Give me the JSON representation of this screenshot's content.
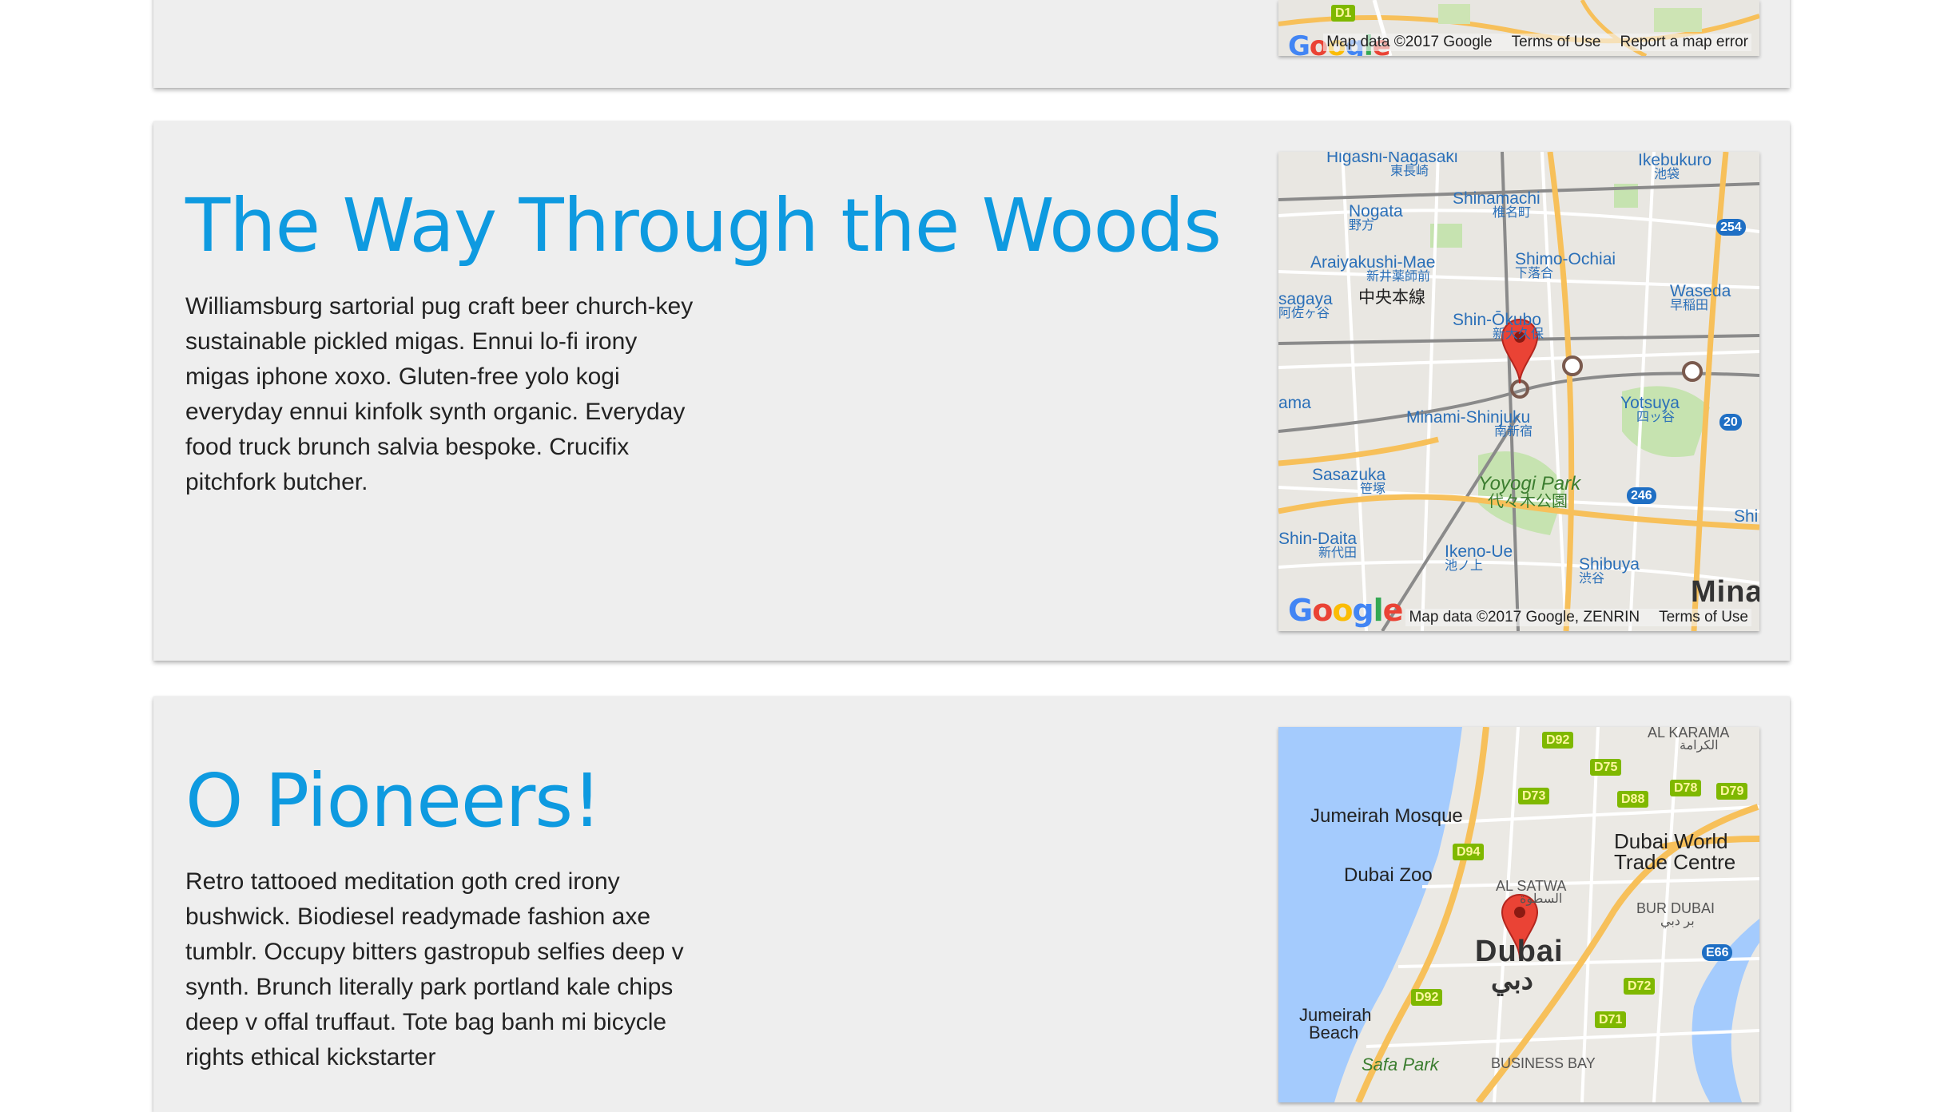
{
  "cards": [
    {
      "map": {
        "attribution": [
          "Map data ©2017 Google",
          "Terms of Use",
          "Report a map error"
        ],
        "logo": "Google",
        "partial_labels": [
          "D1"
        ]
      }
    },
    {
      "title": "The Way Through the Woods",
      "body": "Williamsburg sartorial pug craft beer church-key sustainable pickled migas. Ennui lo-fi irony migas iphone xoxo. Gluten-free yolo kogi everyday ennui kinfolk synth organic. Everyday food truck brunch salvia bespoke. Crucifix pitchfork butcher.",
      "map": {
        "attribution": [
          "Map data ©2017 Google, ZENRIN",
          "Terms of Use"
        ],
        "logo": "Google",
        "places": {
          "higashi_nagasaki": "Higashi-Nagasaki",
          "higashi_nagasaki_jp": "東長崎",
          "ikebukuro": "Ikebukuro",
          "ikebukuro_jp": "池袋",
          "nogata": "Nogata",
          "nogata_jp": "野方",
          "shinamachi": "Shinamachi",
          "shinamachi_jp": "椎名町",
          "araiyakushi": "Araiyakushi-Mae",
          "araiyakushi_jp": "新井薬師前",
          "shimo_ochiai": "Shimo-Ochiai",
          "shimo_ochiai_jp": "下落合",
          "waseda": "Waseda",
          "waseda_jp": "早稲田",
          "asagaya": "sagaya",
          "asagaya_jp": "阿佐ヶ谷",
          "chuo_line": "中央本線",
          "shin_okubo": "Shin-Ōkubo",
          "shin_okubo_jp": "新大久保",
          "ama": "ama",
          "minami_shinjuku": "Minami-Shinjuku",
          "minami_shinjuku_jp": "南新宿",
          "yotsuya": "Yotsuya",
          "yotsuya_jp": "四ッ谷",
          "sasazuka": "Sasazuka",
          "sasazuka_jp": "笹塚",
          "yoyogi": "Yoyogi Park",
          "yoyogi_jp": "代々木公園",
          "shin_daita": "Shin-Daita",
          "shin_daita_jp": "新代田",
          "ikeno_ue": "Ikeno-Ue",
          "ikeno_ue_jp": "池ノ上",
          "shibuya": "Shibuya",
          "shibuya_jp": "渋谷",
          "mina": "Mina",
          "shi": "Shi"
        },
        "shields": [
          "254",
          "20",
          "246"
        ]
      }
    },
    {
      "title": "O Pioneers!",
      "body": "Retro tattooed meditation goth cred irony bushwick. Biodiesel readymade fashion axe tumblr. Occupy bitters gastropub selfies deep v synth. Brunch literally park portland kale chips deep v offal truffaut. Tote bag banh mi bicycle rights ethical kickstarter",
      "map": {
        "places": {
          "al_karama": "AL KARAMA",
          "al_karama_ar": "الكرامة",
          "jumeirah_mosque": "Jumeirah Mosque",
          "dubai_world": "Dubai World",
          "trade_centre": "Trade Centre",
          "dubai_zoo": "Dubai Zoo",
          "al_satwa": "AL SATWA",
          "al_satwa_ar": "السطوة",
          "bur_dubai": "BUR DUBAI",
          "bur_dubai_ar": "بر دبي",
          "dubai": "Dubai",
          "dubai_ar": "دبي",
          "jumeirah": "Jumeirah",
          "beach": "Beach",
          "safa_park": "Safa Park",
          "business_bay": "BUSINESS BAY"
        },
        "shields": [
          "D92",
          "D75",
          "D73",
          "D88",
          "D78",
          "D79",
          "D94",
          "E66",
          "D92",
          "D72",
          "D71"
        ]
      }
    }
  ],
  "colors": {
    "title": "#0e9ae0",
    "card_bg": "#eeeeee",
    "pin": "#ea4335",
    "water": "#a4cbfd"
  }
}
